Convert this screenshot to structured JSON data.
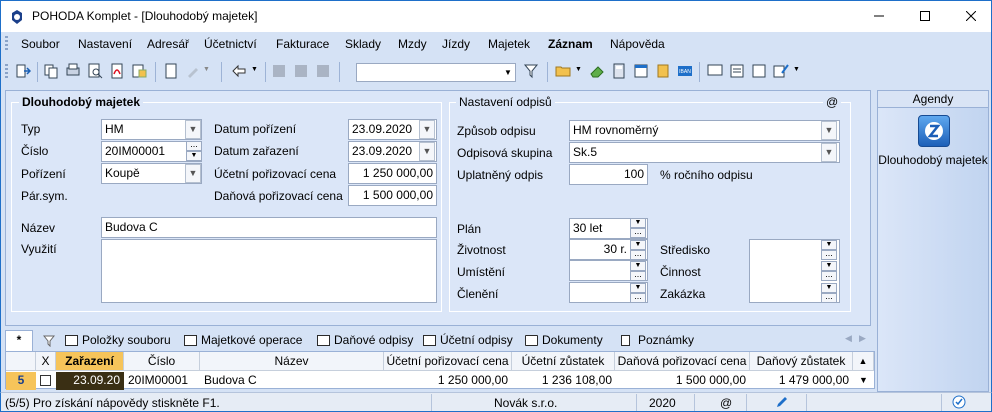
{
  "window": {
    "title": "POHODA Komplet - [Dlouhodobý majetek]",
    "min_icon": "minimize-icon",
    "max_icon": "maximize-icon",
    "close_icon": "close-icon"
  },
  "menu": [
    "Soubor",
    "Nastavení",
    "Adresář",
    "Účetnictví",
    "Fakturace",
    "Sklady",
    "Mzdy",
    "Jízdy",
    "Majetek",
    "Záznam",
    "Nápověda"
  ],
  "toolbar": {
    "combo_value": ""
  },
  "form": {
    "section_title": "Dlouhodobý majetek",
    "typ_label": "Typ",
    "typ_value": "HM",
    "cislo_label": "Číslo",
    "cislo_value": "20IM00001",
    "porizeni_label": "Pořízení",
    "porizeni_value": "Koupě",
    "parsym_label": "Pár.sym.",
    "datum_porizeni_label": "Datum pořízení",
    "datum_porizeni_value": "23.09.2020",
    "datum_zarazeni_label": "Datum zařazení",
    "datum_zarazeni_value": "23.09.2020",
    "ucetni_cena_label": "Účetní pořizovací cena",
    "ucetni_cena_value": "1 250 000,00",
    "danova_cena_label": "Daňová pořizovací cena",
    "danova_cena_value": "1 500 000,00",
    "nazev_label": "Název",
    "nazev_value": "Budova C",
    "vyuziti_label": "Využití",
    "vyuziti_value": ""
  },
  "odpisy": {
    "title": "Nastavení odpisů",
    "at": "@",
    "zpusob_label": "Způsob odpisu",
    "zpusob_value": "HM rovnoměrný",
    "skupina_label": "Odpisová skupina",
    "skupina_value": "Sk.5",
    "uplatneny_label": "Uplatněný odpis",
    "uplatneny_value": "100",
    "uplatneny_unit": "% ročního odpisu",
    "plan_label": "Plán",
    "plan_value": "30 let",
    "zivotnost_label": "Životnost",
    "zivotnost_value": "30 r.",
    "umisteni_label": "Umístění",
    "cleneni_label": "Členění",
    "stredisko_label": "Středisko",
    "cinnost_label": "Činnost",
    "zakazka_label": "Zakázka"
  },
  "agendy": {
    "header": "Agendy",
    "item_label": "Dlouhodobý majetek",
    "item_icon": "asset-icon"
  },
  "tabs": {
    "star": "*",
    "items": [
      "Položky souboru",
      "Majetkové operace",
      "Daňové odpisy",
      "Účetní odpisy",
      "Dokumenty",
      "Poznámky"
    ]
  },
  "table": {
    "headers": [
      "X",
      "Zařazení",
      "Číslo",
      "Název",
      "Účetní pořizovací cena",
      "Účetní zůstatek",
      "Daňová pořizovací cena",
      "Daňový zůstatek"
    ],
    "row": {
      "index": "5",
      "zarazeni": "23.09.20",
      "cislo": "20IM00001",
      "nazev": "Budova C",
      "ucetni_cena": "1 250 000,00",
      "ucetni_zustatek": "1 236 108,00",
      "danova_cena": "1 500 000,00",
      "danovy_zustatek": "1 479 000,00"
    }
  },
  "status": {
    "help": "(5/5) Pro získání nápovědy stiskněte F1.",
    "company": "Novák s.r.o.",
    "year": "2020",
    "at": "@"
  },
  "colors": {
    "accent": "#1e6fc9",
    "panel": "#d5e2f5",
    "highlight": "#f6c45a"
  }
}
